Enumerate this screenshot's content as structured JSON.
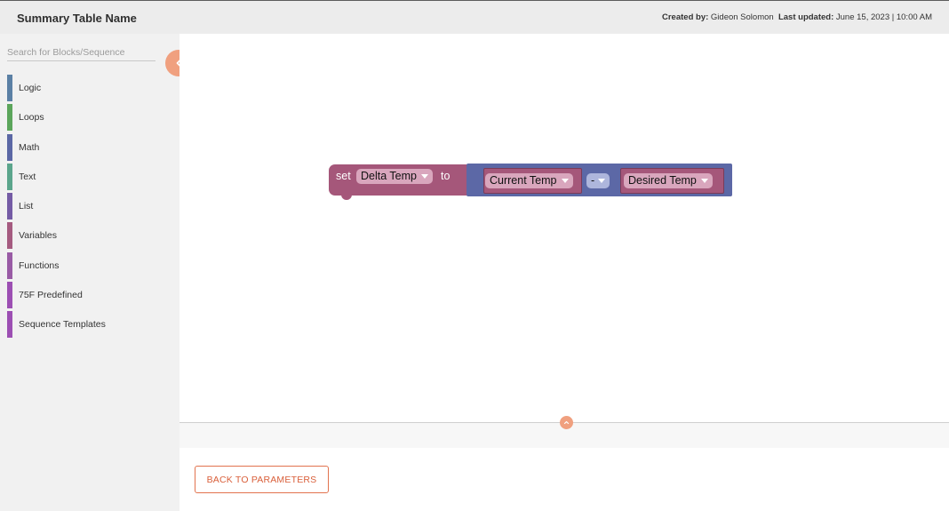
{
  "header": {
    "title": "Summary Table Name",
    "created_by_label": "Created by:",
    "created_by": "Gideon Solomon",
    "updated_label": "Last updated:",
    "updated": "June 15, 2023 | 10:00 AM"
  },
  "sidebar": {
    "search_placeholder": "Search for Blocks/Sequence",
    "categories": [
      {
        "label": "Logic",
        "color": "#5b80a5"
      },
      {
        "label": "Loops",
        "color": "#5ba55b"
      },
      {
        "label": "Math",
        "color": "#5b67a5"
      },
      {
        "label": "Text",
        "color": "#5ba58c"
      },
      {
        "label": "List",
        "color": "#745ba5"
      },
      {
        "label": "Variables",
        "color": "#a55b80"
      },
      {
        "label": "Functions",
        "color": "#995ba5"
      },
      {
        "label": "75F Predefined",
        "color": "#9c4fb3"
      },
      {
        "label": "Sequence Templates",
        "color": "#9c4fb3"
      }
    ]
  },
  "workspace": {
    "block_set": {
      "keyword_set": "set",
      "variable": "Delta Temp",
      "keyword_to": "to",
      "color": "#a55b80"
    },
    "block_math": {
      "left": "Current Temp",
      "operator": "-",
      "right": "Desired Temp",
      "color": "#5b67a5"
    }
  },
  "footer": {
    "back_button": "BACK TO PARAMETERS"
  },
  "colors": {
    "accent": "#f0a07f",
    "button_text": "#d95f3a"
  }
}
